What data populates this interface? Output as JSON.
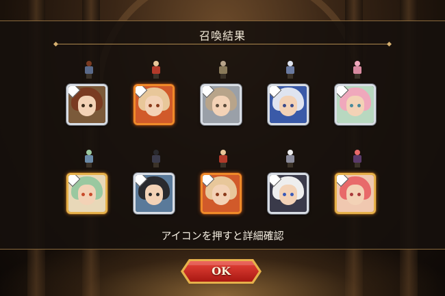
{
  "screen": {
    "title": "召喚結果",
    "hint": "アイコンを押すと詳細確認"
  },
  "ok_button": {
    "label": "OK"
  },
  "theme": {
    "accent_gold": "#e6b14b",
    "button_red": "#c2261e",
    "panel_bg": "#16100c"
  },
  "units": [
    {
      "frame": "silver",
      "hair": "#7a3b22",
      "bg": "#7b5a3a",
      "eye": "#3a2a1a",
      "sprite": "#5a6a8a"
    },
    {
      "frame": "orange",
      "hair": "#e8c79a",
      "bg": "#d15a2a",
      "eye": "#8a3a1a",
      "sprite": "#b23a2a"
    },
    {
      "frame": "silver",
      "hair": "#b8a48a",
      "bg": "#9aa0a8",
      "eye": "#5a4a3a",
      "sprite": "#8a7a5a"
    },
    {
      "frame": "silver",
      "hair": "#dfe4f0",
      "bg": "#3a5aa8",
      "eye": "#3a4a8a",
      "sprite": "#6a7aa0"
    },
    {
      "frame": "silver",
      "hair": "#f0a8bc",
      "bg": "#b8d8c0",
      "eye": "#4a8a9a",
      "sprite": "#d88aa0"
    },
    {
      "frame": "gold",
      "hair": "#9ac8a0",
      "bg": "#e8d8b8",
      "eye": "#c84a2a",
      "sprite": "#6a8aa8"
    },
    {
      "frame": "silver",
      "hair": "#2a2a2e",
      "bg": "#5a7a9a",
      "eye": "#2a2a2a",
      "sprite": "#3a3a4a"
    },
    {
      "frame": "orange",
      "hair": "#e8c79a",
      "bg": "#d15a2a",
      "eye": "#8a3a1a",
      "sprite": "#b23a2a"
    },
    {
      "frame": "silver",
      "hair": "#eeeeee",
      "bg": "#3a3a4a",
      "eye": "#3a5ab8",
      "sprite": "#8a8a9a"
    },
    {
      "frame": "gold",
      "hair": "#e86a6a",
      "bg": "#f0c8b0",
      "eye": "#a83a3a",
      "sprite": "#5a3a6a"
    }
  ]
}
